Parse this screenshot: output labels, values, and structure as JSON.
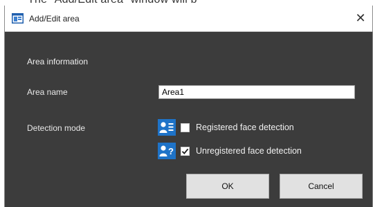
{
  "caption": "The \"Add/Edit area\" window will b",
  "window": {
    "title": "Add/Edit area",
    "close_glyph": "✕",
    "app_icon": "app-window-icon"
  },
  "form": {
    "section_title": "Area information",
    "area_name_label": "Area name",
    "area_name_value": "Area1",
    "detection_mode_label": "Detection mode",
    "options": [
      {
        "label": "Registered face detection",
        "checked": false,
        "icon": "registered-person-list-icon"
      },
      {
        "label": "Unregistered face detection",
        "checked": true,
        "icon": "unknown-person-icon"
      }
    ]
  },
  "buttons": {
    "ok": "OK",
    "cancel": "Cancel"
  },
  "colors": {
    "dialog_background": "#3c3c3c",
    "icon_blue": "#1e73c8",
    "button_face": "#e1e1e1"
  }
}
